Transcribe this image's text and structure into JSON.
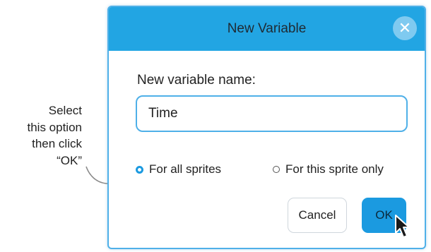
{
  "callout": {
    "lines": [
      "Select",
      "this option",
      "then click",
      "“OK”"
    ]
  },
  "dialog": {
    "title": "New Variable",
    "close_icon": "close-icon",
    "close_glyph": "✕",
    "field_label": "New variable name:",
    "name_value": "Time",
    "scope_options": [
      {
        "label": "For all sprites",
        "selected": true
      },
      {
        "label": "For this sprite only",
        "selected": false
      }
    ],
    "cancel_label": "Cancel",
    "ok_label": "OK"
  },
  "colors": {
    "header": "#22a5e3",
    "accent": "#1b9ae0",
    "border": "#4fb0e8"
  }
}
